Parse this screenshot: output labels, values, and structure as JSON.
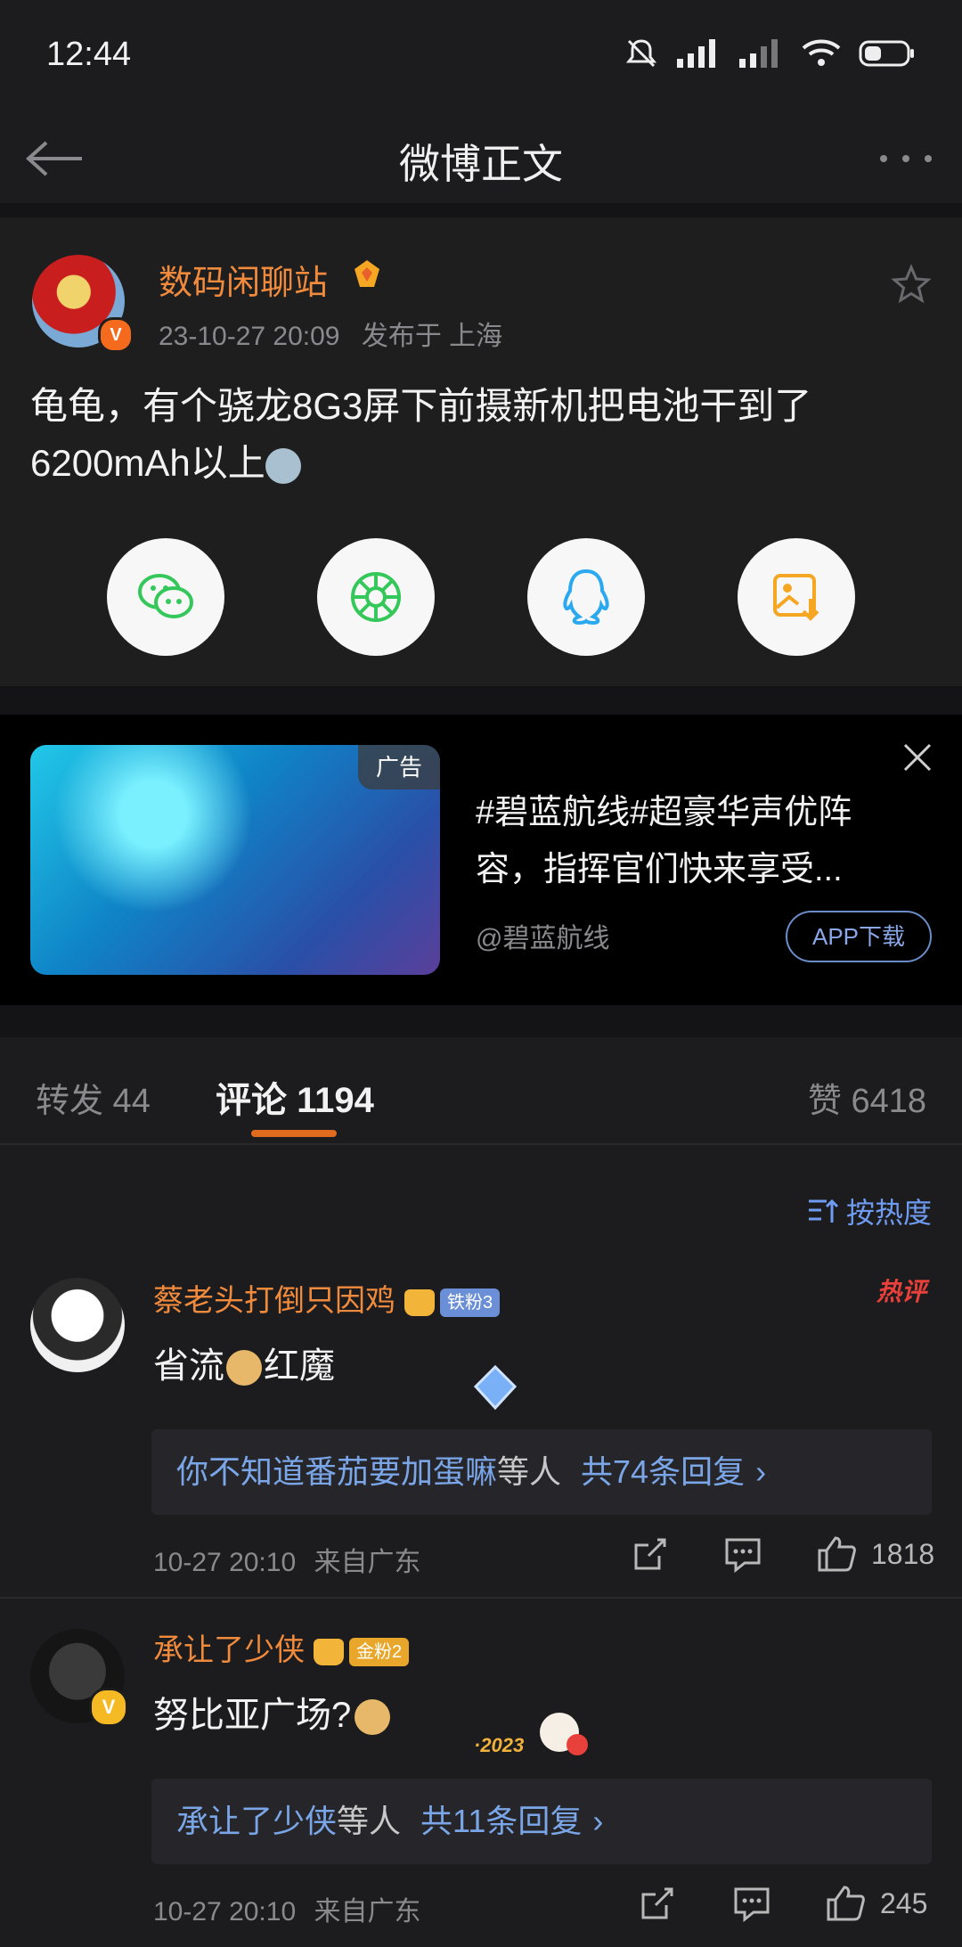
{
  "status_bar": {
    "time": "12:44"
  },
  "header": {
    "title": "微博正文"
  },
  "post": {
    "author": "数码闲聊站",
    "date": "23-10-27 20:09",
    "location": "发布于 上海",
    "content_line1": "龟龟，有个骁龙8G3屏下前摄新机把电池干到了",
    "content_line2": "6200mAh以上"
  },
  "share": [
    {
      "name": "wechat",
      "icon": "wechat-icon",
      "color": "#34c759"
    },
    {
      "name": "moments",
      "icon": "moments-icon",
      "color": "#34c759"
    },
    {
      "name": "qq",
      "icon": "qq-icon",
      "color": "#2aa8f0"
    },
    {
      "name": "save-image",
      "icon": "image-download-icon",
      "color": "#f5a623"
    }
  ],
  "ad": {
    "tag": "广告",
    "text_line1": "#碧蓝航线#超豪华声优阵",
    "text_line2": "容，指挥官们快来享受...",
    "source": "@碧蓝航线",
    "button": "APP下载"
  },
  "tabs": {
    "repost": "转发 44",
    "comment": "评论 1194",
    "like": "赞 6418"
  },
  "sort": {
    "label": "按热度"
  },
  "comments": [
    {
      "name": "蔡老头打倒只因鸡",
      "fan_badge": "铁粉3",
      "text_a": "省流",
      "text_b": "红魔",
      "reply_users": "你不知道番茄要加蛋嘛",
      "reply_suffix": "等人",
      "reply_count": "共74条回复",
      "time": "10-27 20:10",
      "location": "来自广东",
      "likes": "1818",
      "hot_badge": "热评"
    },
    {
      "name": "承让了少侠",
      "fan_badge": "金粉2",
      "text_a": "努比亚广场?",
      "text_b": "",
      "reply_users": "承让了少侠",
      "reply_suffix": "等人",
      "reply_count": "共11条回复",
      "time": "10-27 20:10",
      "location": "来自广东",
      "likes": "245"
    }
  ]
}
